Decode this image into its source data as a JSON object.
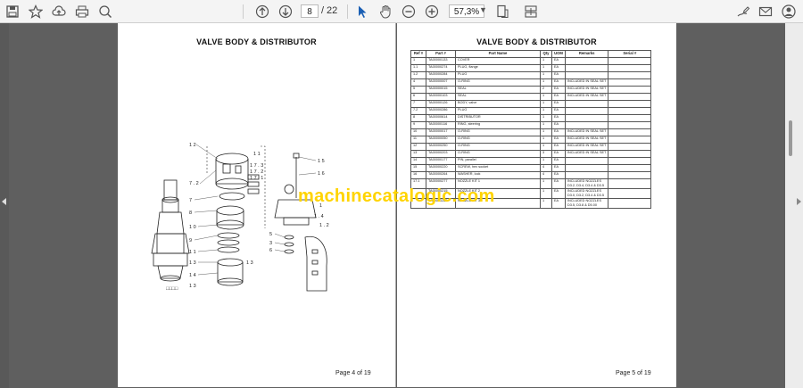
{
  "toolbar": {
    "page_current": "8",
    "page_separator": "/",
    "page_total": "22",
    "zoom_value": "57,3%",
    "icons": [
      "save-icon",
      "bookmark-icon",
      "upload-icon",
      "print-icon",
      "zoom-search-icon",
      "prev-page-icon",
      "next-page-icon",
      "select-cursor-icon",
      "hand-tool-icon",
      "zoom-out-icon",
      "zoom-in-icon",
      "fit-page-icon",
      "scroll-mode-icon",
      "sign-icon",
      "email-icon",
      "account-icon"
    ]
  },
  "left_page": {
    "title": "VALVE BODY & DISTRIBUTOR",
    "footer": "Page 4 of 19",
    "callouts": [
      "12",
      "11",
      "7.2",
      "17.3",
      "7",
      "8",
      "10",
      "9",
      "11",
      "13",
      "14",
      "13",
      "17.1",
      "17.2",
      "15",
      "16",
      "1.4",
      "1.2",
      "5",
      "3",
      "1",
      "6",
      "2",
      "4",
      "13",
      "1"
    ]
  },
  "right_page": {
    "title": "VALVE BODY & DISTRIBUTOR",
    "footer": "Page 5 of 19",
    "columns": [
      "Ref #",
      "Part #",
      "Part Name",
      "Qty",
      "UOM",
      "Remarks",
      "Serial #"
    ],
    "rows": [
      [
        "1",
        "TA00000133",
        "COVER",
        "1",
        "EA",
        "",
        ""
      ],
      [
        "1.1",
        "TA00000274",
        "PLUG, flange",
        "1",
        "EA",
        "",
        ""
      ],
      [
        "1.2",
        "TA00000284",
        "PLUG",
        "1",
        "EA",
        "",
        ""
      ],
      [
        "4",
        "TA00000007",
        "O-RING",
        "1",
        "EA",
        "INCLUDED IN SEAL SET",
        ""
      ],
      [
        "5",
        "TA00000015",
        "SEAL",
        "2",
        "EA",
        "INCLUDED IN SEAL SET",
        ""
      ],
      [
        "6",
        "TA00000103",
        "SEAL",
        "1",
        "EA",
        "INCLUDED IN SEAL SET",
        ""
      ],
      [
        "7",
        "TA00000126",
        "BODY, valve",
        "1",
        "EA",
        "",
        ""
      ],
      [
        "7.2",
        "TA00000286",
        "PLUG",
        "1",
        "EA",
        "",
        ""
      ],
      [
        "8",
        "TA00000614",
        "DISTRIBUTOR",
        "1",
        "EA",
        "",
        ""
      ],
      [
        "9",
        "TA00000116",
        "RING, steering",
        "1",
        "EA",
        "",
        ""
      ],
      [
        "10",
        "TA00000017",
        "O-RING",
        "1",
        "EA",
        "INCLUDED IN SEAL SET",
        ""
      ],
      [
        "11",
        "TA00000050",
        "O-RING",
        "1",
        "EA",
        "INCLUDED IN SEAL SET",
        ""
      ],
      [
        "12",
        "TA00000250",
        "O-RING",
        "1",
        "EA",
        "INCLUDED IN SEAL SET",
        ""
      ],
      [
        "13",
        "TA00000203",
        "O-RING",
        "3",
        "EA",
        "INCLUDED IN SEAL SET",
        ""
      ],
      [
        "14",
        "TA00000177",
        "PIN, parallel",
        "1",
        "EA",
        "",
        ""
      ],
      [
        "15",
        "TA00000220",
        "SCREW, hex socket",
        "4",
        "EA",
        "",
        ""
      ],
      [
        "16",
        "TA00000264",
        "WASHER, lock",
        "4",
        "EA",
        "",
        ""
      ],
      [
        "17.1",
        "TA00000277",
        "NOZZLE KIT 1",
        "1",
        "EA",
        "INCLUDED NOZZLES D3.2, D3.4, D3.4 & D3.5",
        ""
      ],
      [
        "",
        "TA00000215",
        "NOZZLE KIT 2",
        "1",
        "EA",
        "INCLUDED NOZZLES D3.0, D3.2, D3.4 & D3.5",
        ""
      ],
      [
        "",
        "TA00000288",
        "NOZZLE KIT 3",
        "1",
        "EA",
        "INCLUDED NOZZLES D3.5, D3.8 & D5.00",
        ""
      ]
    ]
  },
  "watermark": "machinecatalogic.com",
  "colors": {
    "viewer_bg": "#5f5f5f",
    "toolbar_bg": "#f4f4f4",
    "select_tool_accent": "#1a5fb4",
    "watermark": "#ffd400"
  }
}
